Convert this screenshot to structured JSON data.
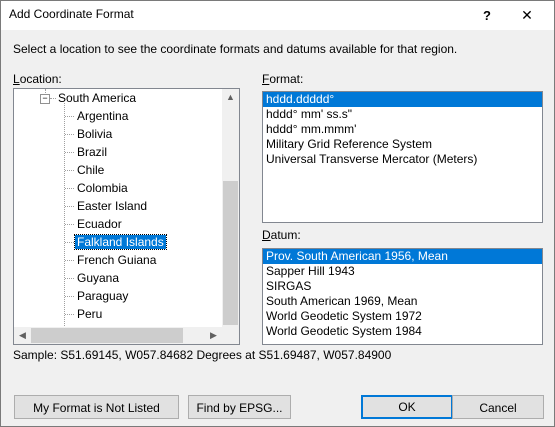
{
  "window": {
    "title": "Add Coordinate Format",
    "help_glyph": "?",
    "close_glyph": "✕"
  },
  "instructions": "Select a location to see the coordinate formats and datums available for that region.",
  "location": {
    "label": "Location:",
    "label_mnemonic": "L",
    "label_rest": "ocation:",
    "expander": "−",
    "parent": "South America",
    "children": [
      "Argentina",
      "Bolivia",
      "Brazil",
      "Chile",
      "Colombia",
      "Easter Island",
      "Ecuador",
      "Falkland Islands",
      "French Guiana",
      "Guyana",
      "Paraguay",
      "Peru"
    ],
    "selected": "Falkland Islands"
  },
  "format": {
    "label_mnemonic": "F",
    "label_rest": "ormat:",
    "items": [
      "hddd.ddddd°",
      "hddd° mm' ss.s\"",
      "hddd° mm.mmm'",
      "Military Grid Reference System",
      "Universal Transverse Mercator (Meters)"
    ],
    "selected_index": 0
  },
  "datum": {
    "label_mnemonic": "D",
    "label_rest": "atum:",
    "items": [
      "Prov. South American 1956, Mean",
      "Sapper Hill 1943",
      "SIRGAS",
      "South American 1969, Mean",
      "World Geodetic System 1972",
      "World Geodetic System 1984"
    ],
    "selected_index": 0
  },
  "sample": "Sample: S51.69145, W057.84682 Degrees at S51.69487, W057.84900",
  "buttons": {
    "not_listed": "My Format is Not Listed",
    "find_epsg": "Find by EPSG...",
    "ok": "OK",
    "cancel": "Cancel"
  },
  "scroll_arrows": {
    "up": "▲",
    "down": "▼",
    "left": "◀",
    "right": "▶"
  }
}
